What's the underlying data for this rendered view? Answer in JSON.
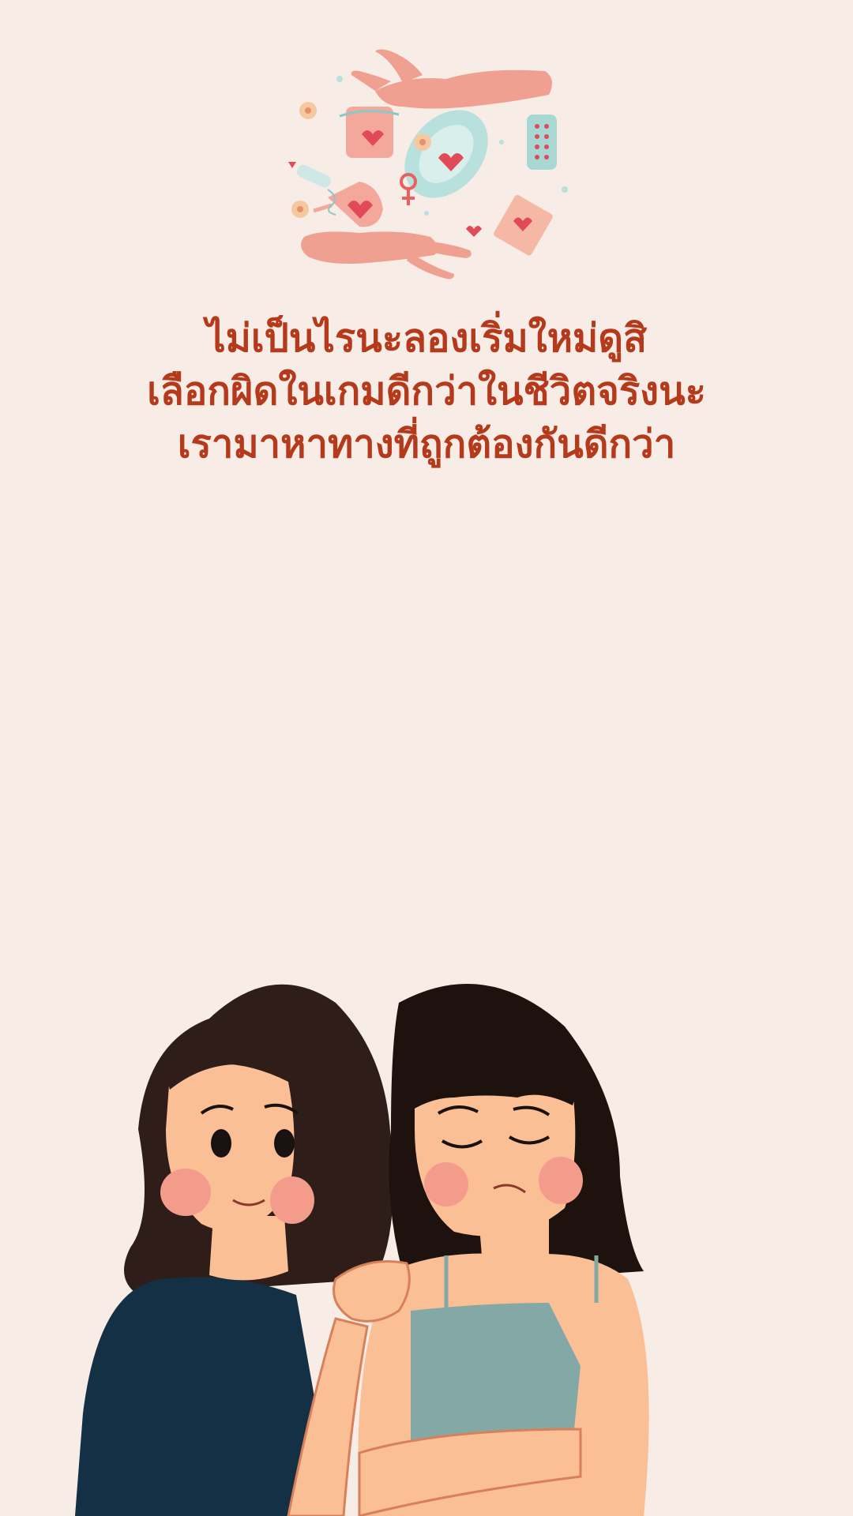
{
  "screen": {
    "background_color": "#f7ece6",
    "text_color": "#b53a1c"
  },
  "message": {
    "line1": "ไม่เป็นไรนะลองเริ่มใหม่ดูสิ",
    "line2": "เลือกผิดในเกมดีกว่าในชีวิตจริงนะ",
    "line3": "เรามาหาทางที่ถูกต้องกันดีกว่า"
  },
  "illustrations": {
    "top": "menstrual-care-products-illustration",
    "bottom": "two-women-comforting-illustration"
  }
}
